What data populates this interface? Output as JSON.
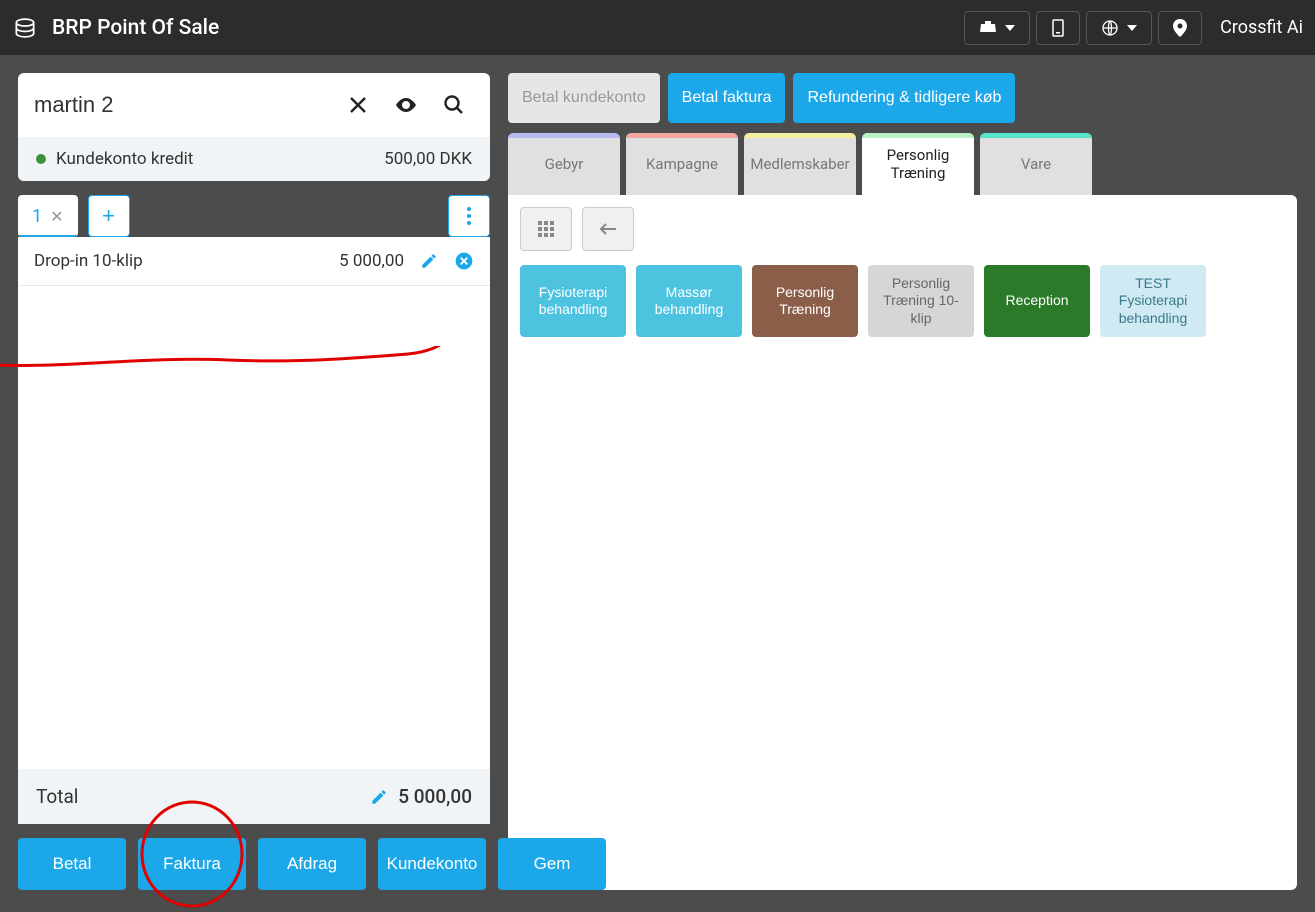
{
  "header": {
    "title": "BRP Point Of Sale",
    "location": "Crossfit Ai"
  },
  "search": {
    "value": "martin 2",
    "credit_label": "Kundekonto kredit",
    "credit_amount": "500,00 DKK"
  },
  "cart": {
    "tab_number": "1",
    "line_name": "Drop-in 10-klip",
    "line_price": "5 000,00",
    "total_label": "Total",
    "total_value": "5 000,00"
  },
  "actions": {
    "betal": "Betal",
    "faktura": "Faktura",
    "afdrag": "Afdrag",
    "kundekonto": "Kundekonto",
    "gem": "Gem"
  },
  "topActions": {
    "betal_kundekonto": "Betal kundekonto",
    "betal_faktura": "Betal faktura",
    "refundering": "Refundering & tidligere køb"
  },
  "categories": {
    "gebyr": "Gebyr",
    "kampagne": "Kampagne",
    "medlemskaber": "Medlemskaber",
    "personlig": "Personlig Træning",
    "vare": "Vare"
  },
  "products": {
    "fysio": "Fysioterapi behandling",
    "massor": "Massør behandling",
    "personlig": "Personlig Træning",
    "pt10": "Personlig Træning 10-klip",
    "reception": "Reception",
    "test": "TEST Fysioterapi behandling"
  }
}
